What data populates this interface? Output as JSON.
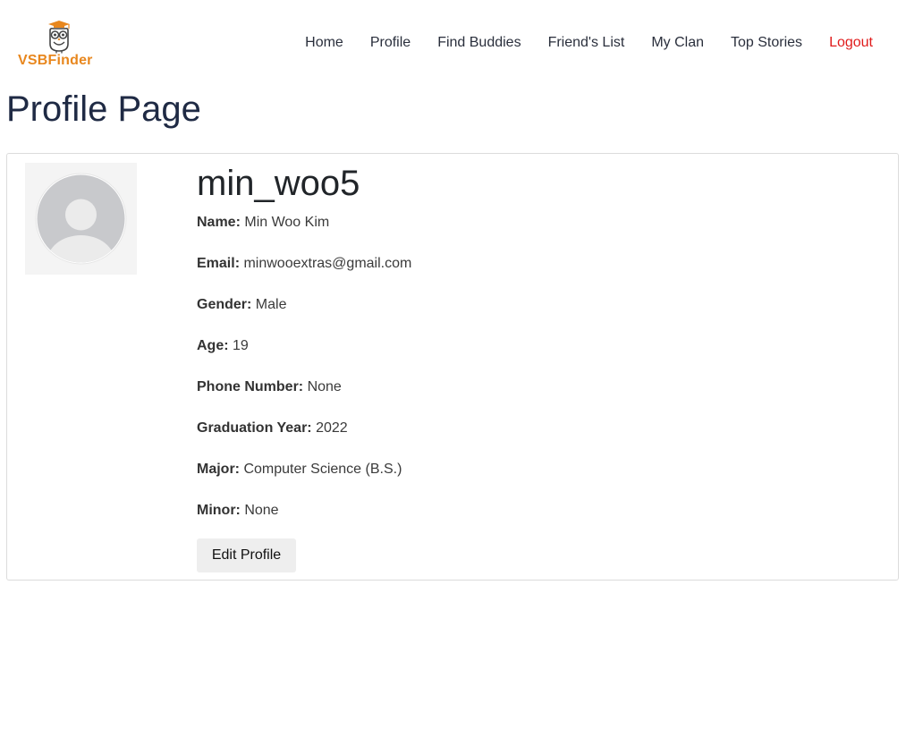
{
  "brand": {
    "name": "VSBFinder",
    "accent_color": "#e8871e",
    "icon": "owl-logo-icon"
  },
  "nav": {
    "items": [
      {
        "label": "Home"
      },
      {
        "label": "Profile"
      },
      {
        "label": "Find Buddies"
      },
      {
        "label": "Friend's List"
      },
      {
        "label": "My Clan"
      },
      {
        "label": "Top Stories"
      },
      {
        "label": "Logout"
      }
    ],
    "logout_color": "#e01b1b"
  },
  "page": {
    "title": "Profile Page"
  },
  "profile": {
    "avatar_icon": "default-user-avatar-icon",
    "username": "min_woo5",
    "fields": [
      {
        "label": "Name:",
        "value": "Min Woo Kim"
      },
      {
        "label": "Email:",
        "value": "minwooextras@gmail.com"
      },
      {
        "label": "Gender:",
        "value": "Male"
      },
      {
        "label": "Age:",
        "value": "19"
      },
      {
        "label": "Phone Number:",
        "value": "None"
      },
      {
        "label": "Graduation Year:",
        "value": "2022"
      },
      {
        "label": "Major:",
        "value": "Computer Science (B.S.)"
      },
      {
        "label": "Minor:",
        "value": "None"
      }
    ],
    "edit_button": "Edit Profile"
  }
}
